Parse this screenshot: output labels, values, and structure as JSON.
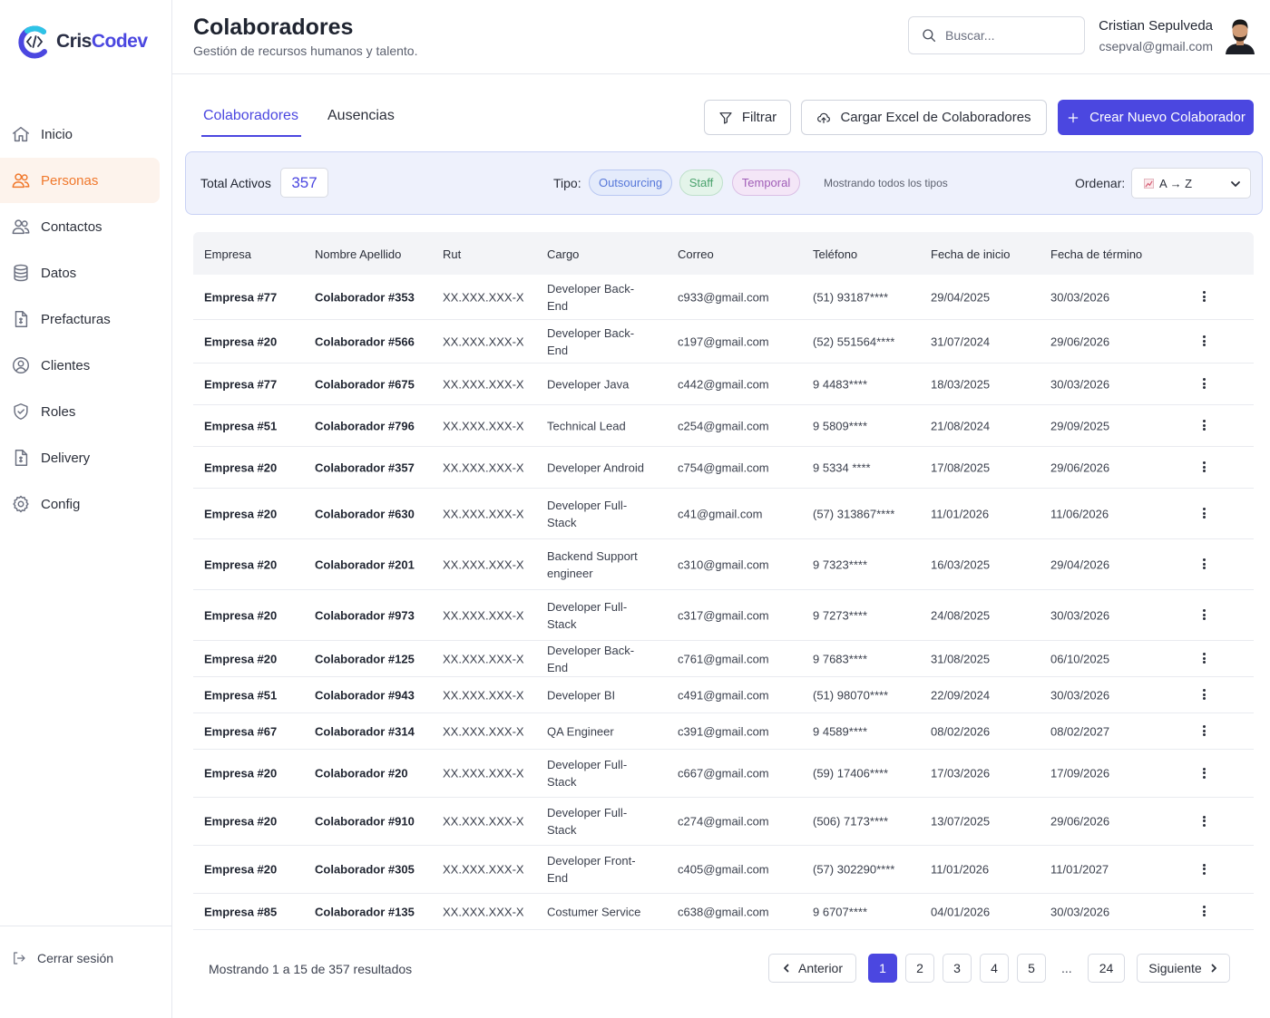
{
  "brand": {
    "name_a": "Cris",
    "name_b": "Codev"
  },
  "sidebar": {
    "items": [
      {
        "label": "Inicio",
        "icon": "home-icon"
      },
      {
        "label": "Personas",
        "icon": "users-icon",
        "active": true
      },
      {
        "label": "Contactos",
        "icon": "contacts-icon"
      },
      {
        "label": "Datos",
        "icon": "database-icon"
      },
      {
        "label": "Prefacturas",
        "icon": "invoice-icon"
      },
      {
        "label": "Clientes",
        "icon": "user-circle-icon"
      },
      {
        "label": "Roles",
        "icon": "shield-icon"
      },
      {
        "label": "Delivery",
        "icon": "document-icon"
      },
      {
        "label": "Config",
        "icon": "gear-icon"
      }
    ],
    "logout": "Cerrar sesión"
  },
  "header": {
    "title": "Colaboradores",
    "subtitle": "Gestión de recursos humanos y talento.",
    "search_placeholder": "Buscar...",
    "user_name": "Cristian Sepulveda",
    "user_email": "csepval@gmail.com"
  },
  "tabs": [
    {
      "label": "Colaboradores",
      "active": true
    },
    {
      "label": "Ausencias",
      "active": false
    }
  ],
  "actions": {
    "filter": "Filtrar",
    "upload": "Cargar Excel de Colaboradores",
    "create": "Crear Nuevo Colaborador"
  },
  "summary": {
    "total_label": "Total Activos",
    "total_value": "357",
    "tipo_label": "Tipo:",
    "chips": [
      "Outsourcing",
      "Staff",
      "Temporal"
    ],
    "showing_types": "Mostrando todos los tipos",
    "sort_label": "Ordenar:",
    "sort_value": "A → Z"
  },
  "colors": {
    "accent": "#4b47e0",
    "active_nav": "#f0782c"
  },
  "table": {
    "headers": [
      "Empresa",
      "Nombre Apellido",
      "Rut",
      "Cargo",
      "Correo",
      "Teléfono",
      "Fecha de inicio",
      "Fecha de término"
    ],
    "rows": [
      [
        "Empresa #77",
        "Colaborador #353",
        "XX.XXX.XXX-X",
        "Developer Back-End",
        "c933@gmail.com",
        "(51) 93187****",
        "29/04/2025",
        "30/03/2026"
      ],
      [
        "Empresa #20",
        "Colaborador #566",
        "XX.XXX.XXX-X",
        "Developer Back-End",
        "c197@gmail.com",
        "(52) 551564****",
        "31/07/2024",
        "29/06/2026"
      ],
      [
        "Empresa #77",
        "Colaborador #675",
        "XX.XXX.XXX-X",
        "Developer Java",
        "c442@gmail.com",
        "9 4483****",
        "18/03/2025",
        "30/03/2026"
      ],
      [
        "Empresa #51",
        "Colaborador #796",
        "XX.XXX.XXX-X",
        "Technical Lead",
        "c254@gmail.com",
        "9 5809****",
        "21/08/2024",
        "29/09/2025"
      ],
      [
        "Empresa #20",
        "Colaborador #357",
        "XX.XXX.XXX-X",
        "Developer Android",
        "c754@gmail.com",
        "9 5334 ****",
        "17/08/2025",
        "29/06/2026"
      ],
      [
        "Empresa #20",
        "Colaborador #630",
        "XX.XXX.XXX-X",
        "Developer Full-Stack",
        "c41@gmail.com",
        "(57) 313867****",
        "11/01/2026",
        "11/06/2026"
      ],
      [
        "Empresa #20",
        "Colaborador #201",
        "XX.XXX.XXX-X",
        "Backend Support engineer",
        "c310@gmail.com",
        "9 7323****",
        "16/03/2025",
        "29/04/2026"
      ],
      [
        "Empresa #20",
        "Colaborador #973",
        "XX.XXX.XXX-X",
        "Developer Full-Stack",
        "c317@gmail.com",
        "9 7273****",
        "24/08/2025",
        "30/03/2026"
      ],
      [
        "Empresa #20",
        "Colaborador #125",
        "XX.XXX.XXX-X",
        "Developer Back-End",
        "c761@gmail.com",
        "9 7683****",
        "31/08/2025",
        "06/10/2025"
      ],
      [
        "Empresa #51",
        "Colaborador #943",
        "XX.XXX.XXX-X",
        "Developer BI",
        "c491@gmail.com",
        "(51) 98070****",
        "22/09/2024",
        "30/03/2026"
      ],
      [
        "Empresa #67",
        "Colaborador #314",
        "XX.XXX.XXX-X",
        "QA Engineer",
        "c391@gmail.com",
        "9 4589****",
        "08/02/2026",
        "08/02/2027"
      ],
      [
        "Empresa #20",
        "Colaborador #20",
        "XX.XXX.XXX-X",
        "Developer Full-Stack",
        "c667@gmail.com",
        "(59) 17406****",
        "17/03/2026",
        "17/09/2026"
      ],
      [
        "Empresa #20",
        "Colaborador #910",
        "XX.XXX.XXX-X",
        "Developer Full-Stack",
        "c274@gmail.com",
        "(506) 7173****",
        "13/07/2025",
        "29/06/2026"
      ],
      [
        "Empresa #20",
        "Colaborador #305",
        "XX.XXX.XXX-X",
        "Developer Front-End",
        "c405@gmail.com",
        "(57) 302290****",
        "11/01/2026",
        "11/01/2027"
      ],
      [
        "Empresa #85",
        "Colaborador #135",
        "XX.XXX.XXX-X",
        "Costumer Service",
        "c638@gmail.com",
        "9 6707****",
        "04/01/2026",
        "30/03/2026"
      ]
    ]
  },
  "pagination": {
    "results_text": "Mostrando 1 a 15 de 357 resultados",
    "prev": "Anterior",
    "next": "Siguiente",
    "pages": [
      "1",
      "2",
      "3",
      "4",
      "5",
      "24"
    ],
    "current": "1",
    "ellipsis": "..."
  }
}
